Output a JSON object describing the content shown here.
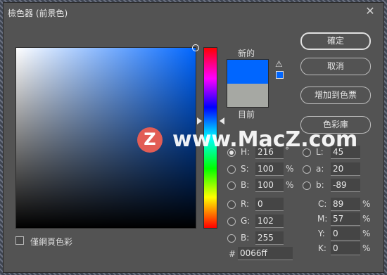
{
  "window": {
    "title": "檢色器 (前景色)"
  },
  "swatches": {
    "new_label": "新的",
    "current_label": "目前",
    "new_color": "#0066ff",
    "current_color": "#a6a8a3",
    "warning_icon": "warning-triangle-icon"
  },
  "buttons": {
    "ok": "確定",
    "cancel": "取消",
    "add_to_swatches": "增加到色票",
    "color_libraries": "色彩庫"
  },
  "hsb": {
    "h": {
      "label": "H:",
      "value": "216",
      "unit": "°"
    },
    "s": {
      "label": "S:",
      "value": "100",
      "unit": "%"
    },
    "b": {
      "label": "B:",
      "value": "100",
      "unit": "%"
    }
  },
  "rgb": {
    "r": {
      "label": "R:",
      "value": "0"
    },
    "g": {
      "label": "G:",
      "value": "102"
    },
    "b": {
      "label": "B:",
      "value": "255"
    }
  },
  "lab": {
    "l": {
      "label": "L:",
      "value": "45"
    },
    "a": {
      "label": "a:",
      "value": "20"
    },
    "b": {
      "label": "b:",
      "value": "-89"
    }
  },
  "cmyk": {
    "c": {
      "label": "C:",
      "value": "89",
      "unit": "%"
    },
    "m": {
      "label": "M:",
      "value": "57",
      "unit": "%"
    },
    "y": {
      "label": "Y:",
      "value": "0",
      "unit": "%"
    },
    "k": {
      "label": "K:",
      "value": "0",
      "unit": "%"
    }
  },
  "hex": {
    "label": "#",
    "value": "0066ff"
  },
  "web_colors_only": {
    "label": "僅網頁色彩",
    "checked": false
  },
  "watermark": {
    "logo": "Z",
    "text": "www.MacZ.com"
  }
}
